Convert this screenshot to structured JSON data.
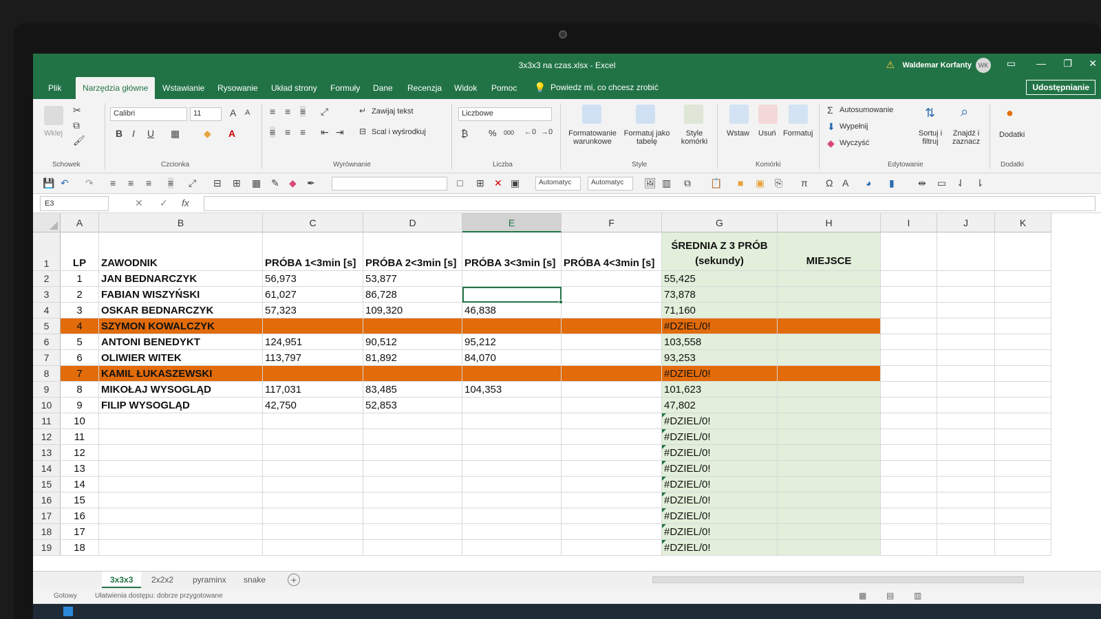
{
  "window": {
    "title": "3x3x3 na czas.xlsx  -  Excel",
    "user_name": "Waldemar Korfanty",
    "user_initials": "WK",
    "share_label": "Udostępnianie"
  },
  "ribbon_tabs": [
    "Plik",
    "Narzędzia główne",
    "Wstawianie",
    "Rysowanie",
    "Układ strony",
    "Formuły",
    "Dane",
    "Recenzja",
    "Widok",
    "Pomoc"
  ],
  "active_tab": "Narzędzia główne",
  "tell_me": "Powiedz mi, co chcesz zrobić",
  "ribbon": {
    "clipboard": {
      "paste": "Wklej",
      "group": "Schowek"
    },
    "font": {
      "name": "Calibri",
      "size": "11",
      "group": "Czcionka",
      "bold": "B",
      "italic": "I",
      "underline": "U"
    },
    "alignment": {
      "wrap": "Zawijaj tekst",
      "merge": "Scal i wyśrodkuj",
      "group": "Wyrównanie"
    },
    "number": {
      "format": "Liczbowe",
      "percent": "%",
      "thousands": "000",
      "group": "Liczba"
    },
    "styles": {
      "conditional": [
        "Formatowanie",
        "warunkowe"
      ],
      "table": [
        "Formatuj jako",
        "tabelę"
      ],
      "cell_styles": [
        "Style",
        "komórki"
      ],
      "group": "Style"
    },
    "cells": {
      "insert": "Wstaw",
      "delete": "Usuń",
      "format": "Formatuj",
      "group": "Komórki"
    },
    "editing": {
      "autosum": "Autosumowanie",
      "fill": "Wypełnij",
      "clear": "Wyczyść",
      "sort": [
        "Sortuj i",
        "filtruj"
      ],
      "find": [
        "Znajdź i",
        "zaznacz"
      ],
      "group": "Edytowanie"
    },
    "addins": {
      "label": "Dodatki",
      "group": "Dodatki"
    }
  },
  "qat": {
    "auto1": "Automatyc",
    "auto2": "Automatyc"
  },
  "formula_bar": {
    "name_box": "E3",
    "fx": "fx",
    "formula": ""
  },
  "columns": [
    "A",
    "B",
    "C",
    "D",
    "E",
    "F",
    "G",
    "H",
    "I",
    "J",
    "K"
  ],
  "selected_column": "E",
  "header_row": {
    "row": "1",
    "A": "LP",
    "B": "ZAWODNIK",
    "C": "PRÓBA 1<3min [s]",
    "D": "PRÓBA 2<3min [s]",
    "E": "PRÓBA 3<3min [s]",
    "F": "PRÓBA 4<3min [s]",
    "G": "ŚREDNIA Z 3 PRÓB (sekundy)",
    "H": "MIEJSCE"
  },
  "rows": [
    {
      "row": "2",
      "lp": "1",
      "name": "JAN BEDNARCZYK",
      "c": "56,973",
      "d": "53,877",
      "e": "",
      "f": "",
      "g": "55,425",
      "h": "",
      "dnf": false
    },
    {
      "row": "3",
      "lp": "2",
      "name": "FABIAN WISZYŃSKI",
      "c": "61,027",
      "d": "86,728",
      "e": "",
      "f": "",
      "g": "73,878",
      "h": "",
      "dnf": false
    },
    {
      "row": "4",
      "lp": "3",
      "name": "OSKAR BEDNARCZYK",
      "c": "57,323",
      "d": "109,320",
      "e": "46,838",
      "f": "",
      "g": "71,160",
      "h": "",
      "dnf": false
    },
    {
      "row": "5",
      "lp": "4",
      "name": "SZYMON KOWALCZYK",
      "c": "",
      "d": "",
      "e": "",
      "f": "",
      "g": "#DZIEL/0!",
      "h": "",
      "dnf": true
    },
    {
      "row": "6",
      "lp": "5",
      "name": "ANTONI BENEDYKT",
      "c": "124,951",
      "d": "90,512",
      "e": "95,212",
      "f": "",
      "g": "103,558",
      "h": "",
      "dnf": false
    },
    {
      "row": "7",
      "lp": "6",
      "name": "OLIWIER WITEK",
      "c": "113,797",
      "d": "81,892",
      "e": "84,070",
      "f": "",
      "g": "93,253",
      "h": "",
      "dnf": false
    },
    {
      "row": "8",
      "lp": "7",
      "name": "KAMIL ŁUKASZEWSKI",
      "c": "",
      "d": "",
      "e": "",
      "f": "",
      "g": "#DZIEL/0!",
      "h": "",
      "dnf": true
    },
    {
      "row": "9",
      "lp": "8",
      "name": "MIKOŁAJ WYSOGLĄD",
      "c": "117,031",
      "d": "83,485",
      "e": "104,353",
      "f": "",
      "g": "101,623",
      "h": "",
      "dnf": false
    },
    {
      "row": "10",
      "lp": "9",
      "name": "FILIP WYSOGLĄD",
      "c": "42,750",
      "d": "52,853",
      "e": "",
      "f": "",
      "g": "47,802",
      "h": "",
      "dnf": false
    },
    {
      "row": "11",
      "lp": "10",
      "name": "",
      "c": "",
      "d": "",
      "e": "",
      "f": "",
      "g": "#DZIEL/0!",
      "h": "",
      "dnf": false
    },
    {
      "row": "12",
      "lp": "11",
      "name": "",
      "c": "",
      "d": "",
      "e": "",
      "f": "",
      "g": "#DZIEL/0!",
      "h": "",
      "dnf": false
    },
    {
      "row": "13",
      "lp": "12",
      "name": "",
      "c": "",
      "d": "",
      "e": "",
      "f": "",
      "g": "#DZIEL/0!",
      "h": "",
      "dnf": false
    },
    {
      "row": "14",
      "lp": "13",
      "name": "",
      "c": "",
      "d": "",
      "e": "",
      "f": "",
      "g": "#DZIEL/0!",
      "h": "",
      "dnf": false
    },
    {
      "row": "15",
      "lp": "14",
      "name": "",
      "c": "",
      "d": "",
      "e": "",
      "f": "",
      "g": "#DZIEL/0!",
      "h": "",
      "dnf": false
    },
    {
      "row": "16",
      "lp": "15",
      "name": "",
      "c": "",
      "d": "",
      "e": "",
      "f": "",
      "g": "#DZIEL/0!",
      "h": "",
      "dnf": false
    },
    {
      "row": "17",
      "lp": "16",
      "name": "",
      "c": "",
      "d": "",
      "e": "",
      "f": "",
      "g": "#DZIEL/0!",
      "h": "",
      "dnf": false
    },
    {
      "row": "18",
      "lp": "17",
      "name": "",
      "c": "",
      "d": "",
      "e": "",
      "f": "",
      "g": "#DZIEL/0!",
      "h": "",
      "dnf": false
    },
    {
      "row": "19",
      "lp": "18",
      "name": "",
      "c": "",
      "d": "",
      "e": "",
      "f": "",
      "g": "#DZIEL/0!",
      "h": "",
      "dnf": false
    }
  ],
  "sheets": [
    "3x3x3",
    "2x2x2",
    "pyraminx",
    "snake"
  ],
  "active_sheet": "3x3x3",
  "status": {
    "ready": "Gotowy",
    "accessibility": "Ułatwienia dostępu: dobrze przygotowane"
  },
  "colors": {
    "excel_green": "#217346",
    "dnf_orange": "#e26b0a",
    "result_green": "#e2efda"
  }
}
